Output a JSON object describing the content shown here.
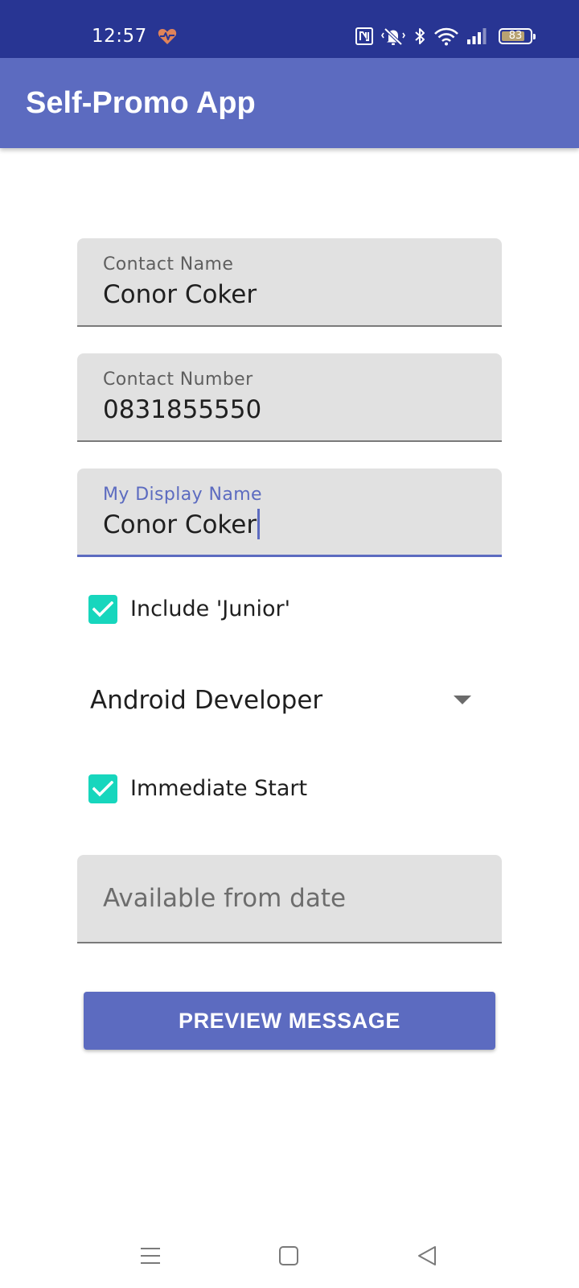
{
  "status_bar": {
    "time": "12:57",
    "battery_level": "83",
    "battery_fraction": 0.83,
    "icons": [
      "heart-rate-icon",
      "nfc-icon",
      "vibrate-mute-icon",
      "bluetooth-icon",
      "wifi-icon",
      "cell-signal-icon",
      "battery-icon"
    ]
  },
  "app_bar": {
    "title": "Self-Promo App"
  },
  "form": {
    "contact_name": {
      "label": "Contact Name",
      "value": "Conor Coker"
    },
    "contact_number": {
      "label": "Contact Number",
      "value": "0831855550"
    },
    "display_name": {
      "label": "My Display Name",
      "value": "Conor Coker"
    },
    "include_junior": {
      "label": "Include 'Junior'",
      "checked": true
    },
    "job_title": {
      "selected": "Android Developer"
    },
    "immediate_start": {
      "label": "Immediate Start",
      "checked": true
    },
    "available_from": {
      "placeholder": "Available from date",
      "value": ""
    },
    "preview_button": {
      "label": "PREVIEW MESSAGE"
    }
  },
  "nav_bar": {
    "icons": [
      "menu-icon",
      "home-icon",
      "back-icon"
    ]
  },
  "colors": {
    "status_bar": "#283593",
    "primary": "#5c6bc0",
    "checkbox_accent": "#17d6bd",
    "field_background": "#e1e1e1"
  }
}
